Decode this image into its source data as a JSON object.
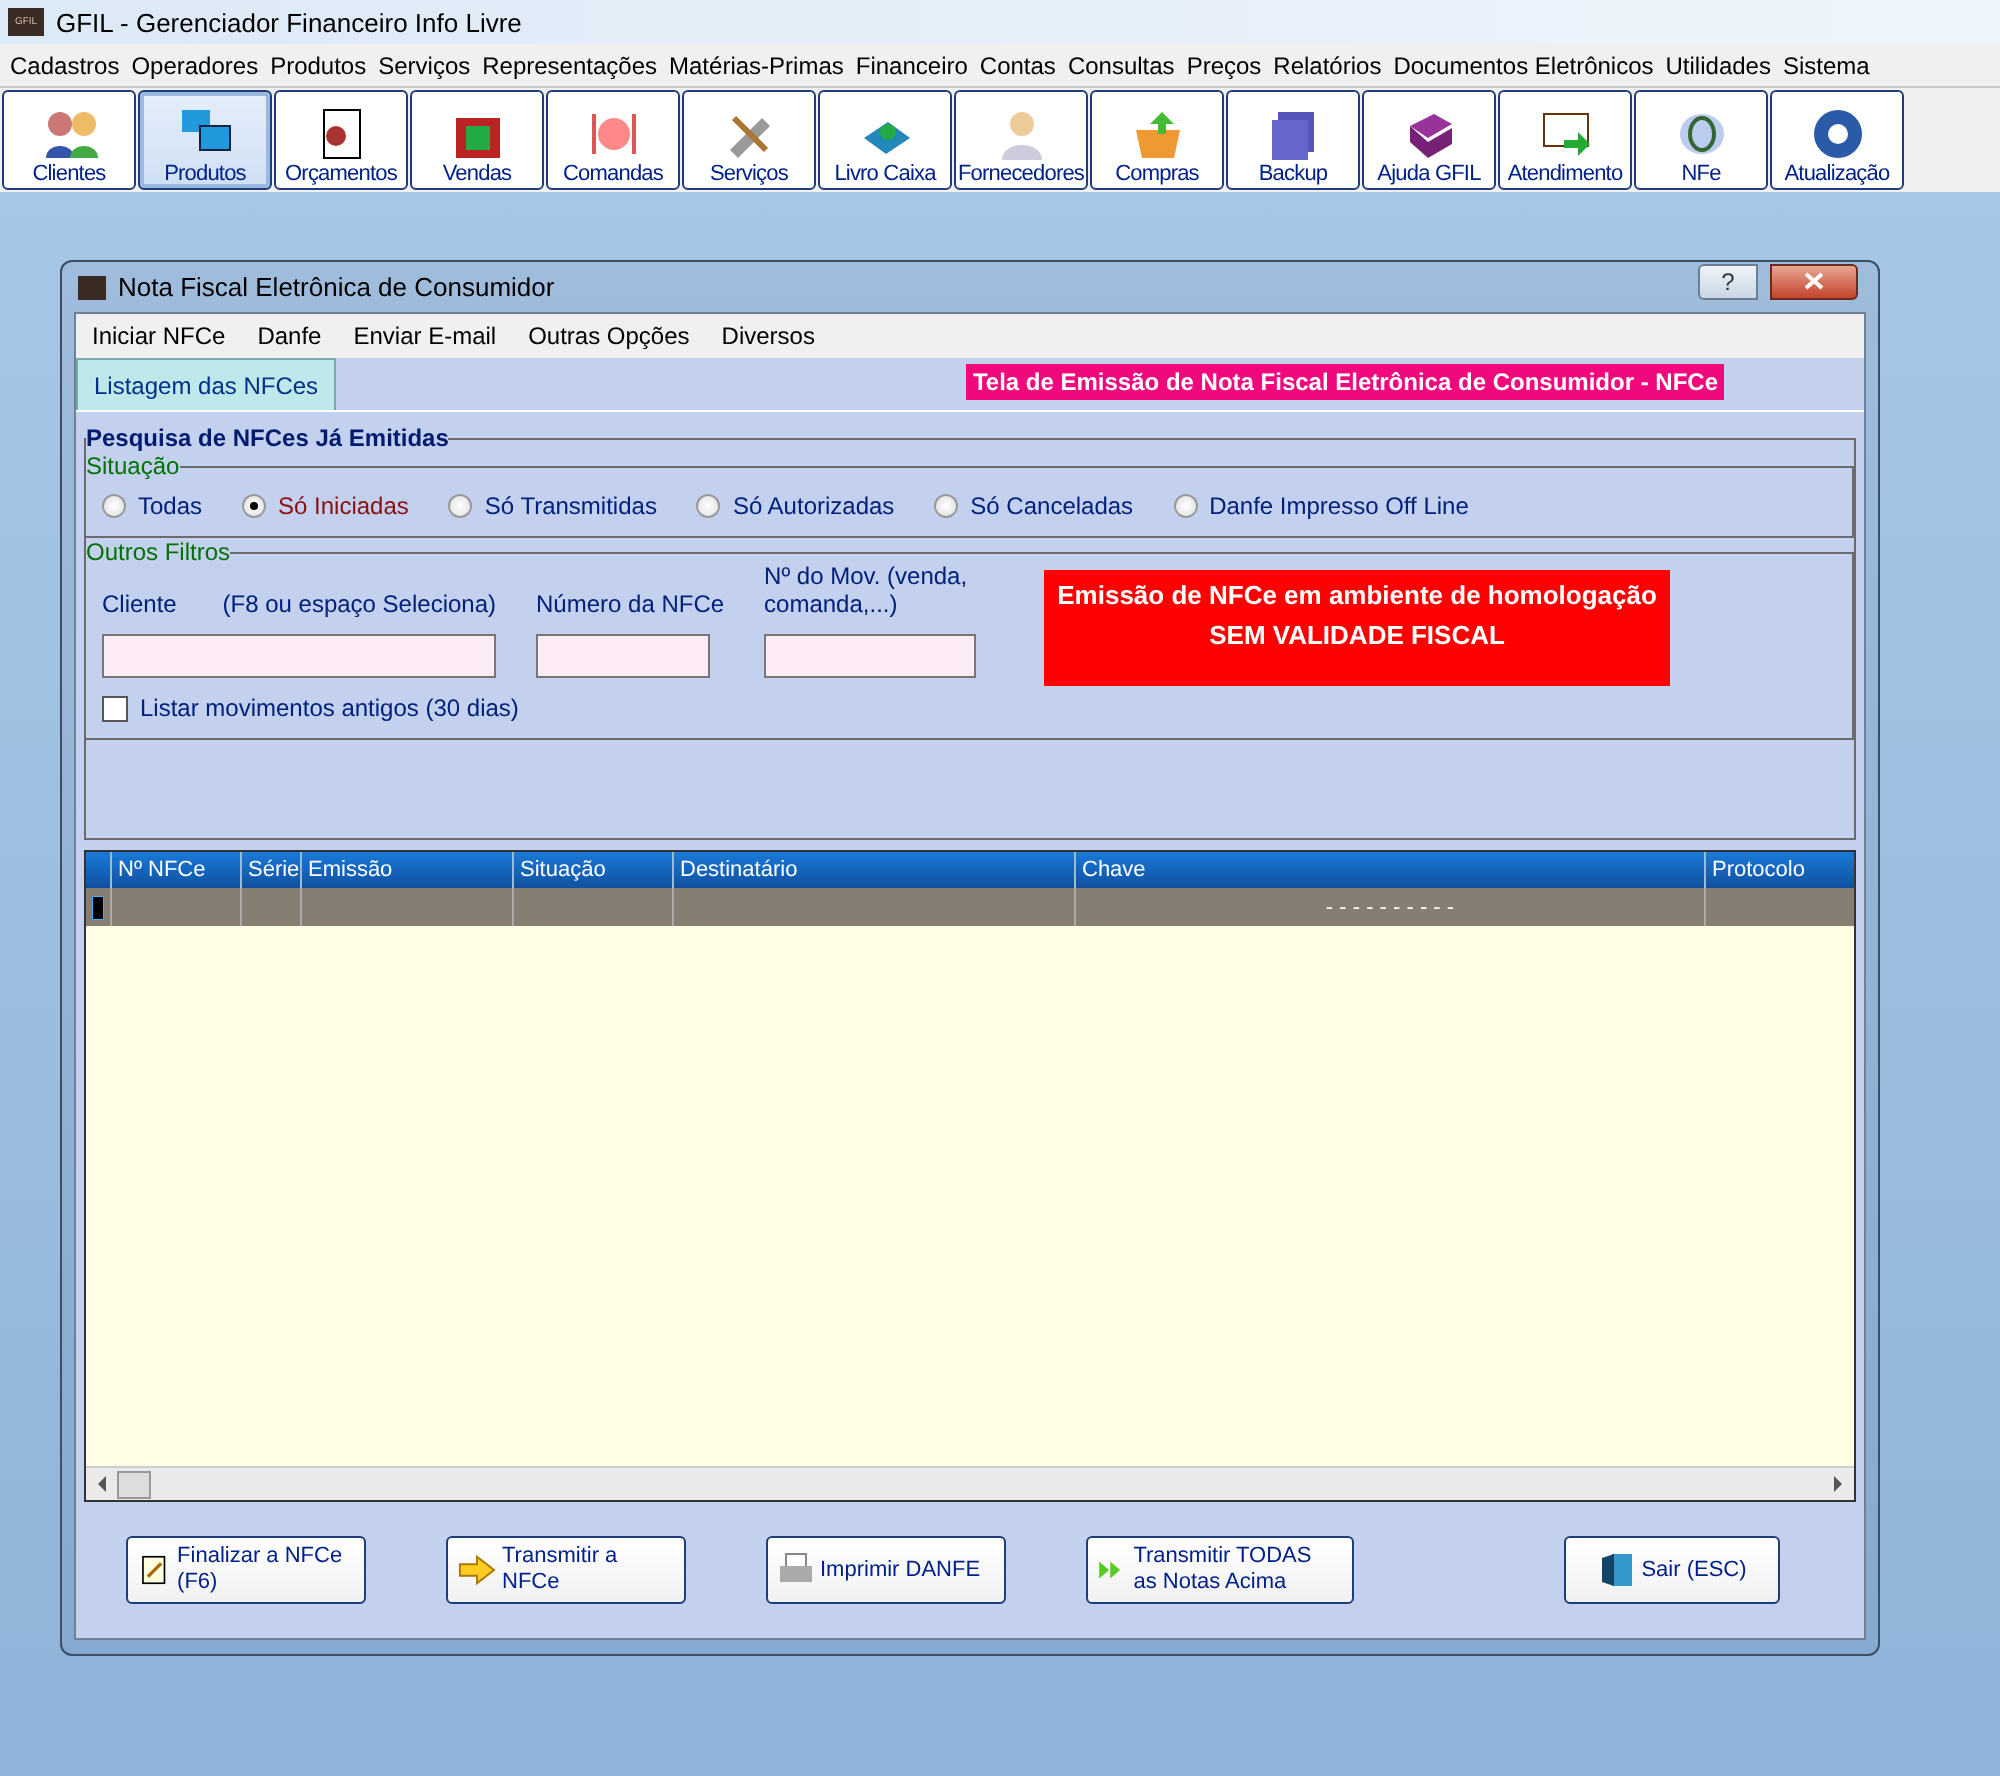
{
  "app": {
    "title": "GFIL - Gerenciador Financeiro Info Livre",
    "logo": "GFIL"
  },
  "menu": [
    "Cadastros",
    "Operadores",
    "Produtos",
    "Serviços",
    "Representações",
    "Matérias-Primas",
    "Financeiro",
    "Contas",
    "Consultas",
    "Preços",
    "Relatórios",
    "Documentos Eletrônicos",
    "Utilidades",
    "Sistema"
  ],
  "toolbar": [
    {
      "label": "Clientes",
      "selected": false
    },
    {
      "label": "Produtos",
      "selected": true
    },
    {
      "label": "Orçamentos",
      "selected": false
    },
    {
      "label": "Vendas",
      "selected": false
    },
    {
      "label": "Comandas",
      "selected": false
    },
    {
      "label": "Serviços",
      "selected": false
    },
    {
      "label": "Livro Caixa",
      "selected": false
    },
    {
      "label": "Fornecedores",
      "selected": false
    },
    {
      "label": "Compras",
      "selected": false
    },
    {
      "label": "Backup",
      "selected": false
    },
    {
      "label": "Ajuda GFIL",
      "selected": false
    },
    {
      "label": "Atendimento",
      "selected": false
    },
    {
      "label": "NFe",
      "selected": false
    },
    {
      "label": "Atualização",
      "selected": false
    }
  ],
  "dialog": {
    "title": "Nota Fiscal Eletrônica de Consumidor",
    "help": "?",
    "menu": [
      "Iniciar NFCe",
      "Danfe",
      "Enviar E-mail",
      "Outras Opções",
      "Diversos"
    ],
    "tabs": [
      {
        "label": "Listagem das NFCes",
        "selected": true
      }
    ],
    "banner": "Tela de Emissão de Nota Fiscal Eletrônica de Consumidor  - NFCe",
    "search": {
      "title": "Pesquisa de NFCes Já Emitidas",
      "situacao": {
        "title": "Situação",
        "options": [
          {
            "label": "Todas",
            "selected": false
          },
          {
            "label": "Só Iniciadas",
            "selected": true
          },
          {
            "label": "Só Transmitidas",
            "selected": false
          },
          {
            "label": "Só Autorizadas",
            "selected": false
          },
          {
            "label": "Só Canceladas",
            "selected": false
          },
          {
            "label": "Danfe Impresso Off Line",
            "selected": false
          }
        ]
      },
      "filters": {
        "title": "Outros Filtros",
        "cliente_label": "Cliente",
        "cliente_hint": "(F8 ou espaço Seleciona)",
        "numero_label": "Número da NFCe",
        "mov_label": "Nº do Mov. (venda, comanda,...)",
        "old_label": "Listar movimentos antigos (30 dias)",
        "old_checked": false
      },
      "warning": [
        "Emissão de NFCe em ambiente de homologação",
        "SEM VALIDADE FISCAL"
      ]
    },
    "table": {
      "columns": [
        "Nº NFCe",
        "Série",
        "Emissão",
        "Situação",
        "Destinatário",
        "Chave",
        "Protocolo"
      ],
      "rows": [
        [
          "",
          "",
          "",
          "",
          "",
          "- - - - - - - - - -",
          ""
        ]
      ]
    },
    "buttons": [
      "Finalizar a NFCe (F6)",
      "Transmitir a NFCe",
      "Imprimir DANFE",
      "Transmitir TODAS as Notas Acima",
      "Sair (ESC)"
    ]
  }
}
